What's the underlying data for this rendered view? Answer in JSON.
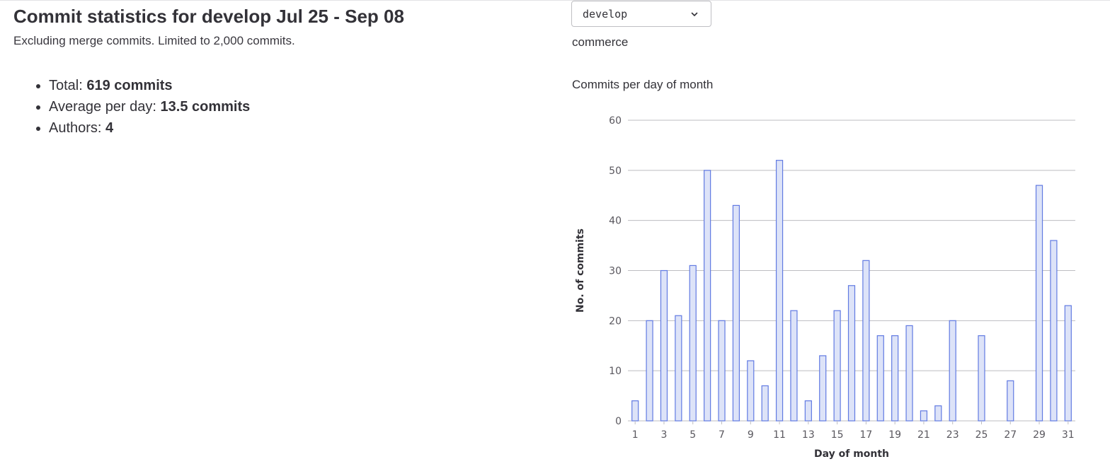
{
  "header": {
    "title": "Commit statistics for develop Jul 25 - Sep 08",
    "subtitle": "Excluding merge commits. Limited to 2,000 commits."
  },
  "stats": [
    {
      "label": "Total: ",
      "value": "619 commits"
    },
    {
      "label": "Average per day: ",
      "value": "13.5 commits"
    },
    {
      "label": "Authors: ",
      "value": "4"
    }
  ],
  "branch_select": {
    "value": "develop",
    "icon": "chevron-down-icon"
  },
  "project": "commerce",
  "chart_title": "Commits per day of month",
  "colors": {
    "bar_fill": "#dde3f8",
    "bar_stroke": "#617ae2",
    "grid": "#bdbdc1"
  },
  "chart_data": {
    "type": "bar",
    "title": "Commits per day of month",
    "xlabel": "Day of month",
    "ylabel": "No. of commits",
    "ylim": [
      0,
      60
    ],
    "yticks": [
      0,
      10,
      20,
      30,
      40,
      50,
      60
    ],
    "xtick_labels": [
      "1",
      "3",
      "5",
      "7",
      "9",
      "11",
      "13",
      "15",
      "17",
      "19",
      "21",
      "23",
      "25",
      "27",
      "29",
      "31"
    ],
    "grid": true,
    "categories": [
      "1",
      "2",
      "3",
      "4",
      "5",
      "6",
      "7",
      "8",
      "9",
      "10",
      "11",
      "12",
      "13",
      "14",
      "15",
      "16",
      "17",
      "18",
      "19",
      "20",
      "21",
      "22",
      "23",
      "24",
      "25",
      "26",
      "27",
      "28",
      "29",
      "30",
      "31"
    ],
    "values": [
      4,
      20,
      30,
      21,
      31,
      50,
      20,
      43,
      12,
      7,
      52,
      22,
      4,
      13,
      22,
      27,
      32,
      17,
      17,
      19,
      2,
      3,
      20,
      0,
      17,
      0,
      8,
      0,
      47,
      36,
      23
    ]
  }
}
